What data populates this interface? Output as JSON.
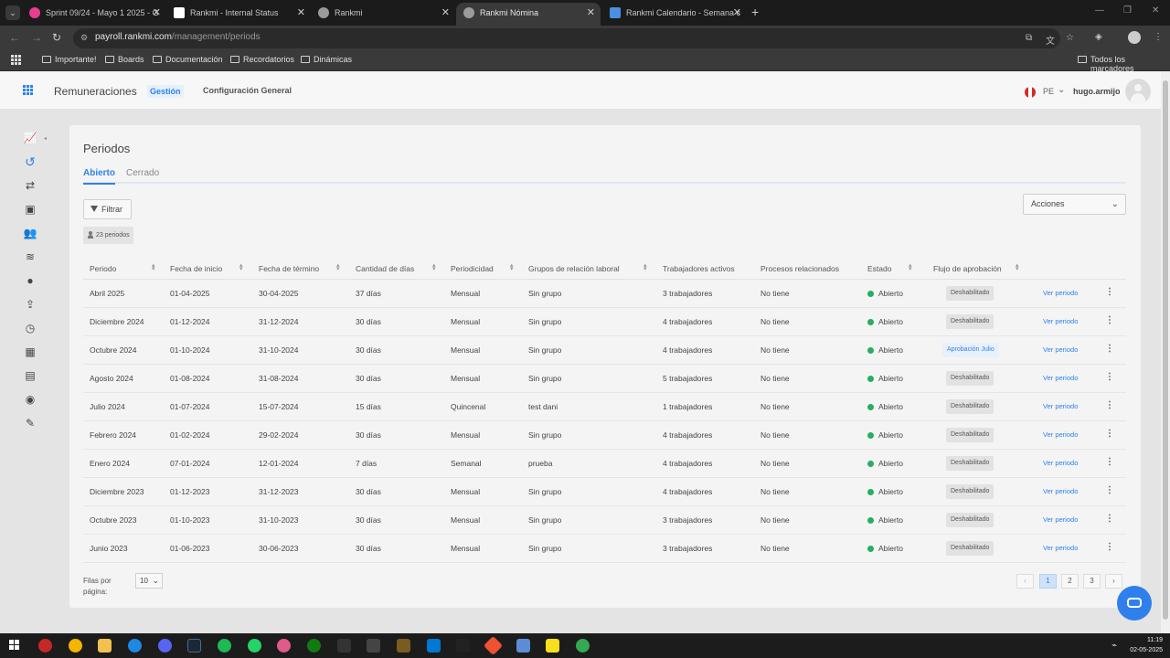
{
  "browser": {
    "tabs": [
      {
        "title": "Sprint 09/24 - Mayo 1 2025 - G",
        "color": "#e83e8c"
      },
      {
        "title": "Rankmi - Internal Status",
        "color": "#ffffff"
      },
      {
        "title": "Rankmi",
        "color": "#9b9b9b"
      },
      {
        "title": "Rankmi Nómina",
        "color": "#9b9b9b"
      },
      {
        "title": "Rankmi Calendario - Semana c",
        "color": "#4a90e2"
      }
    ],
    "url_domain": "payroll.rankmi.com",
    "url_path": "/management/periods",
    "bookmarks": [
      "Importante!",
      "Boards",
      "Documentación",
      "Recordatorios",
      "Dinámicas"
    ],
    "bookmarks_right": "Todos los marcadores"
  },
  "header": {
    "app_title": "Remuneraciones",
    "tab_gestion": "Gestión",
    "tab_config": "Configuración General",
    "country": "PE",
    "username": "hugo.armijo"
  },
  "page": {
    "title": "Periodos",
    "tab_open": "Abierto",
    "tab_closed": "Cerrado",
    "filter_label": "Filtrar",
    "count_label": "23 periodos",
    "actions_label": "Acciones"
  },
  "table": {
    "columns": [
      "Periodo",
      "Fecha de inicio",
      "Fecha de término",
      "Cantidad de días",
      "Periodicidad",
      "Grupos de relación laboral",
      "Trabajadores activos",
      "Procesos relacionados",
      "Estado",
      "Flujo de aprobación"
    ],
    "rows": [
      {
        "periodo": "Abril 2025",
        "inicio": "01-04-2025",
        "termino": "30-04-2025",
        "dias": "37 días",
        "periodicidad": "Mensual",
        "grupo": "Sin grupo",
        "trabajadores": "3 trabajadores",
        "procesos": "No tiene",
        "estado": "Abierto",
        "flujo": "Deshabilitado",
        "accion": "Ver periodo"
      },
      {
        "periodo": "Diciembre 2024",
        "inicio": "01-12-2024",
        "termino": "31-12-2024",
        "dias": "30 días",
        "periodicidad": "Mensual",
        "grupo": "Sin grupo",
        "trabajadores": "4 trabajadores",
        "procesos": "No tiene",
        "estado": "Abierto",
        "flujo": "Deshabilitado",
        "accion": "Ver periodo"
      },
      {
        "periodo": "Octubre 2024",
        "inicio": "01-10-2024",
        "termino": "31-10-2024",
        "dias": "30 días",
        "periodicidad": "Mensual",
        "grupo": "Sin grupo",
        "trabajadores": "4 trabajadores",
        "procesos": "No tiene",
        "estado": "Abierto",
        "flujo": "Aprobación Julio",
        "accion": "Ver periodo"
      },
      {
        "periodo": "Agosto 2024",
        "inicio": "01-08-2024",
        "termino": "31-08-2024",
        "dias": "30 días",
        "periodicidad": "Mensual",
        "grupo": "Sin grupo",
        "trabajadores": "5 trabajadores",
        "procesos": "No tiene",
        "estado": "Abierto",
        "flujo": "Deshabilitado",
        "accion": "Ver periodo"
      },
      {
        "periodo": "Julio 2024",
        "inicio": "01-07-2024",
        "termino": "15-07-2024",
        "dias": "15 días",
        "periodicidad": "Quincenal",
        "grupo": "test dani",
        "trabajadores": "1 trabajadores",
        "procesos": "No tiene",
        "estado": "Abierto",
        "flujo": "Deshabilitado",
        "accion": "Ver periodo"
      },
      {
        "periodo": "Febrero 2024",
        "inicio": "01-02-2024",
        "termino": "29-02-2024",
        "dias": "30 días",
        "periodicidad": "Mensual",
        "grupo": "Sin grupo",
        "trabajadores": "4 trabajadores",
        "procesos": "No tiene",
        "estado": "Abierto",
        "flujo": "Deshabilitado",
        "accion": "Ver periodo"
      },
      {
        "periodo": "Enero 2024",
        "inicio": "07-01-2024",
        "termino": "12-01-2024",
        "dias": "7 días",
        "periodicidad": "Semanal",
        "grupo": "prueba",
        "trabajadores": "4 trabajadores",
        "procesos": "No tiene",
        "estado": "Abierto",
        "flujo": "Deshabilitado",
        "accion": "Ver periodo"
      },
      {
        "periodo": "Diciembre 2023",
        "inicio": "01-12-2023",
        "termino": "31-12-2023",
        "dias": "30 días",
        "periodicidad": "Mensual",
        "grupo": "Sin grupo",
        "trabajadores": "4 trabajadores",
        "procesos": "No tiene",
        "estado": "Abierto",
        "flujo": "Deshabilitado",
        "accion": "Ver periodo"
      },
      {
        "periodo": "Octubre 2023",
        "inicio": "01-10-2023",
        "termino": "31-10-2023",
        "dias": "30 días",
        "periodicidad": "Mensual",
        "grupo": "Sin grupo",
        "trabajadores": "3 trabajadores",
        "procesos": "No tiene",
        "estado": "Abierto",
        "flujo": "Deshabilitado",
        "accion": "Ver periodo"
      },
      {
        "periodo": "Junio 2023",
        "inicio": "01-06-2023",
        "termino": "30-06-2023",
        "dias": "30 días",
        "periodicidad": "Mensual",
        "grupo": "Sin grupo",
        "trabajadores": "3 trabajadores",
        "procesos": "No tiene",
        "estado": "Abierto",
        "flujo": "Deshabilitado",
        "accion": "Ver periodo"
      }
    ]
  },
  "pagination": {
    "rows_label": "Filas por página:",
    "rows_value": "10",
    "pages": [
      "1",
      "2",
      "3"
    ],
    "current": "1"
  },
  "taskbar": {
    "time": "11:19",
    "date": "02-05-2025"
  }
}
